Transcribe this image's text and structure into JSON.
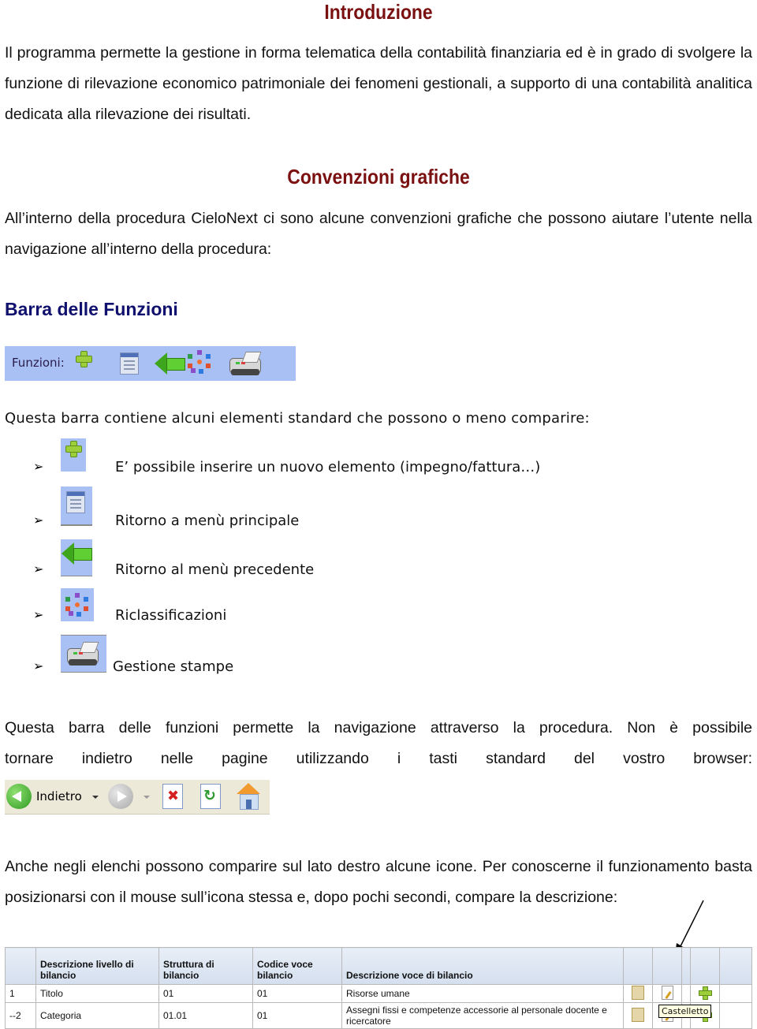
{
  "sections": {
    "intro_title": "Introduzione",
    "intro_text": "Il programma permette la gestione in forma telematica della contabilità finanziaria ed è in grado di svolgere la funzione di rilevazione economico patrimoniale dei fenomeni gestionali, a supporto di una contabilità analitica dedicata alla rilevazione dei risultati.",
    "conv_title": "Convenzioni grafiche",
    "conv_text": "All’interno della procedura CieloNext ci sono alcune convenzioni grafiche che possono aiutare l’utente nella navigazione all’interno della procedura:",
    "barra_title": "Barra delle Funzioni",
    "barra_intro": "Questa barra contiene alcuni elementi standard che possono o meno comparire:",
    "nav_text_1": "Questa barra delle funzioni permette la navigazione attraverso la procedura. Non è possibile",
    "nav_text_2": "tornare indietro nelle pagine utilizzando i tasti standard del vostro browser:",
    "list_text": "Anche negli elenchi possono comparire sul lato destro alcune icone. Per conoscerne il funzionamento basta posizionarsi con il mouse sull’icona stessa e, dopo pochi secondi, compare la descrizione:"
  },
  "funzioni_bar": {
    "label": "Funzioni:",
    "icons": [
      "plus-icon",
      "document-icon",
      "back-arrow-icon",
      "reclassification-icon",
      "printer-icon"
    ],
    "color": "#a9c0f5"
  },
  "legend_items": [
    {
      "icon": "plus-icon",
      "text": "E’ possibile inserire un nuovo elemento (impegno/fattura…)"
    },
    {
      "icon": "document-icon",
      "text": "Ritorno a menù principale"
    },
    {
      "icon": "back-arrow-icon",
      "text": "Ritorno al menù precedente"
    },
    {
      "icon": "reclassification-icon",
      "text": "Riclassificazioni"
    },
    {
      "icon": "printer-icon",
      "text": "Gestione stampe"
    }
  ],
  "browser_toolbar": {
    "back_label": "Indietro",
    "icons": [
      "back-icon",
      "forward-icon",
      "stop-icon",
      "refresh-icon",
      "home-icon"
    ]
  },
  "table": {
    "headers": [
      "",
      "Descrizione livello di bilancio",
      "Struttura di bilancio",
      "Codice voce bilancio",
      "Descrizione voce di bilancio",
      "",
      "",
      "",
      "",
      ""
    ],
    "rows": [
      [
        "1",
        "Titolo",
        "01",
        "01",
        "Risorse umane"
      ],
      [
        "--2",
        "Categoria",
        "01.01",
        "01",
        "Assegni fissi e competenze accessorie al personale docente e ricercatore"
      ]
    ],
    "tooltip": "Castelletto"
  },
  "colors": {
    "heading_red": "#7a1010",
    "heading_blue": "#10106e"
  }
}
